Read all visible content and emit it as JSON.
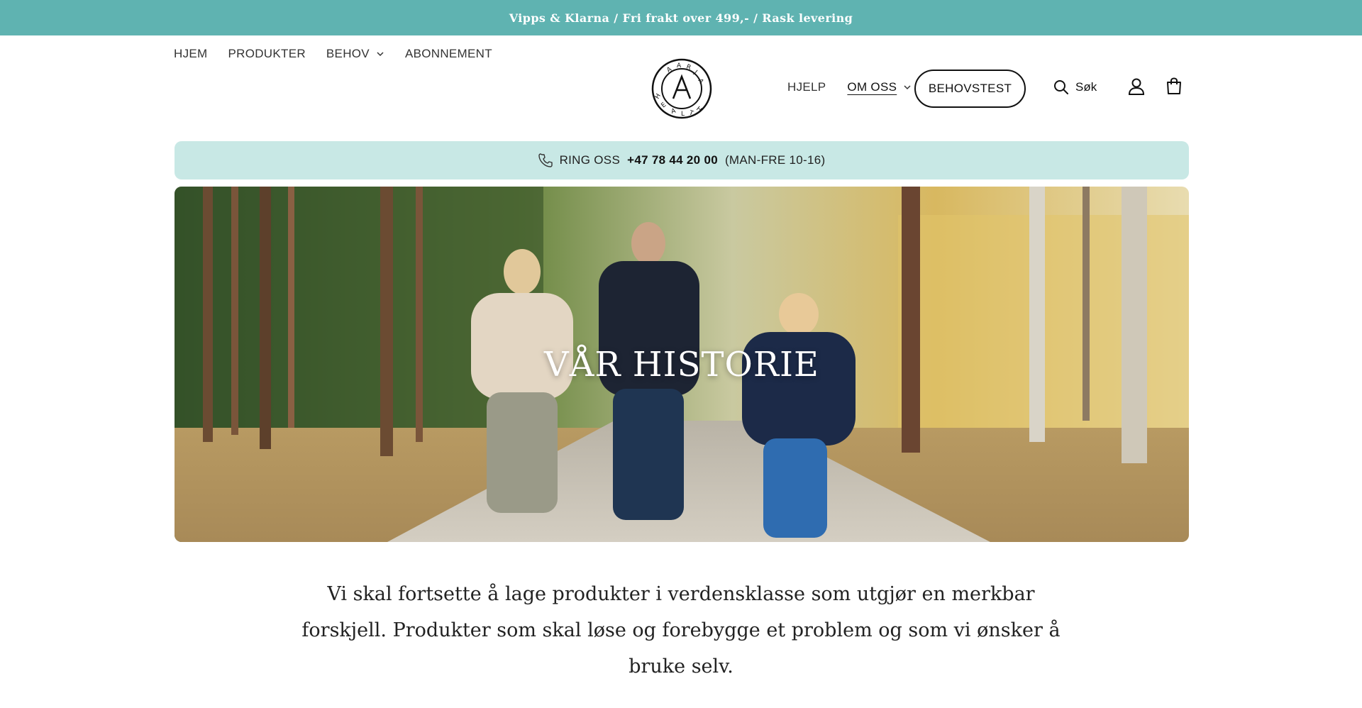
{
  "announcement": "Vipps & Klarna / Fri frakt over 499,- / Rask levering",
  "nav": {
    "left": [
      {
        "label": "HJEM"
      },
      {
        "label": "PRODUKTER"
      },
      {
        "label": "BEHOV"
      },
      {
        "label": "ABONNEMENT"
      }
    ],
    "right": {
      "help": "HJELP",
      "about": "OM OSS",
      "test_button": "BEHOVSTEST",
      "search": "Søk"
    }
  },
  "logo": {
    "brand_text": "AARJA HEALTH"
  },
  "call_banner": {
    "prefix": "RING OSS",
    "phone": "+47 78 44 20 00",
    "hours": "(MAN-FRE 10-16)"
  },
  "hero": {
    "title": "VÅR HISTORIE"
  },
  "story_text": "Vi skal fortsette å lage produkter i verdensklasse som utgjør en merkbar forskjell. Produkter som skal løse og forebygge et problem og som vi ønsker å bruke selv.",
  "colors": {
    "accent": "#5fb3b1",
    "banner_bg": "#c8e8e5"
  },
  "icons": [
    "chevron-down-icon",
    "phone-icon",
    "search-icon",
    "user-icon",
    "cart-icon"
  ]
}
